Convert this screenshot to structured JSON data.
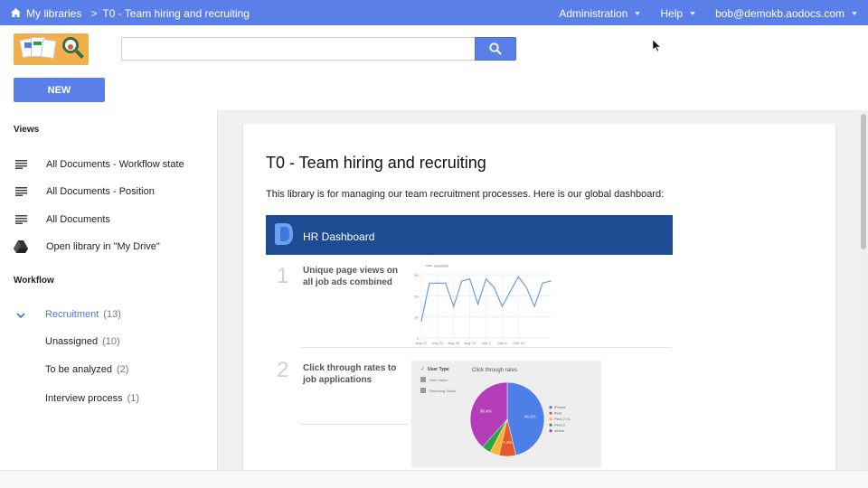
{
  "topbar": {
    "home_label": "My libraries",
    "separator": ">",
    "current_library": "T0 - Team hiring and recruiting",
    "menus": {
      "administration": "Administration",
      "help": "Help",
      "user": "bob@demokb.aodocs.com"
    }
  },
  "header": {
    "search_placeholder": "",
    "new_label": "NEW"
  },
  "sidebar": {
    "views_title": "Views",
    "views": [
      {
        "label": "All Documents - Workflow state",
        "icon": "list-icon"
      },
      {
        "label": "All Documents - Position",
        "icon": "list-icon"
      },
      {
        "label": "All Documents",
        "icon": "list-icon"
      },
      {
        "label": "Open library in \"My Drive\"",
        "icon": "drive-icon"
      }
    ],
    "workflow_title": "Workflow",
    "workflow": [
      {
        "label": "Recruitment",
        "count": "(13)",
        "active": true
      },
      {
        "label": "Unassigned",
        "count": "(10)"
      },
      {
        "label": "To be analyzed",
        "count": "(2)"
      },
      {
        "label": "Interview process",
        "count": "(1)"
      }
    ]
  },
  "main": {
    "title": "T0 - Team hiring and recruiting",
    "description": "This library is for managing our team recruitment processes. Here is our global dashboard:",
    "dashboard": {
      "title": "HR Dashboard",
      "steps": [
        {
          "number": "1",
          "label": "Unique page views on all job ads combined"
        },
        {
          "number": "2",
          "label": "Click through rates to job applications"
        }
      ]
    }
  },
  "chart_data": [
    {
      "type": "line",
      "series": [
        {
          "name": "Sessions",
          "values": [
            8,
            26,
            26,
            26,
            15,
            27,
            28,
            16,
            28,
            24,
            15,
            22,
            29,
            24,
            15,
            26,
            27
          ]
        }
      ],
      "x": [
        "Aug 17",
        "Aug 19",
        "Aug 21",
        "Aug 23",
        "Aug 25",
        "Aug 27",
        "Aug 29",
        "Aug 31",
        "Sep 2",
        "Sep 4",
        "Sep 6",
        "Sep 8",
        "Sep 10",
        "Sep 12",
        "Sep 14",
        "Sep 16",
        "Sep 18"
      ],
      "tick_labels_x": [
        "Aug 17",
        "Aug 21",
        "Aug 25",
        "Aug 29",
        "Sep 2",
        "Sep 6",
        "Sep 10"
      ],
      "tick_labels_y": [
        "0",
        "1K",
        "2K",
        "3K"
      ],
      "ylim": [
        0,
        3
      ],
      "legend": "top-left"
    },
    {
      "type": "pie",
      "title": "Click through rates",
      "filters_title": "User Type",
      "filters": [
        "New Visitor",
        "Returning Visitor"
      ],
      "labels": [
        "iPhone",
        "iPad",
        "Pixel 2 XL",
        "Pixel 2",
        "others"
      ],
      "values": [
        46.2,
        7.4,
        4.0,
        4.0,
        38.4
      ],
      "value_labels": [
        "46.2%",
        "7.4%",
        "",
        "",
        "38.4%"
      ],
      "colors": [
        "#4e7fe6",
        "#e55a2b",
        "#f7b630",
        "#27a34a",
        "#b53eb8"
      ],
      "legend": "right"
    }
  ]
}
